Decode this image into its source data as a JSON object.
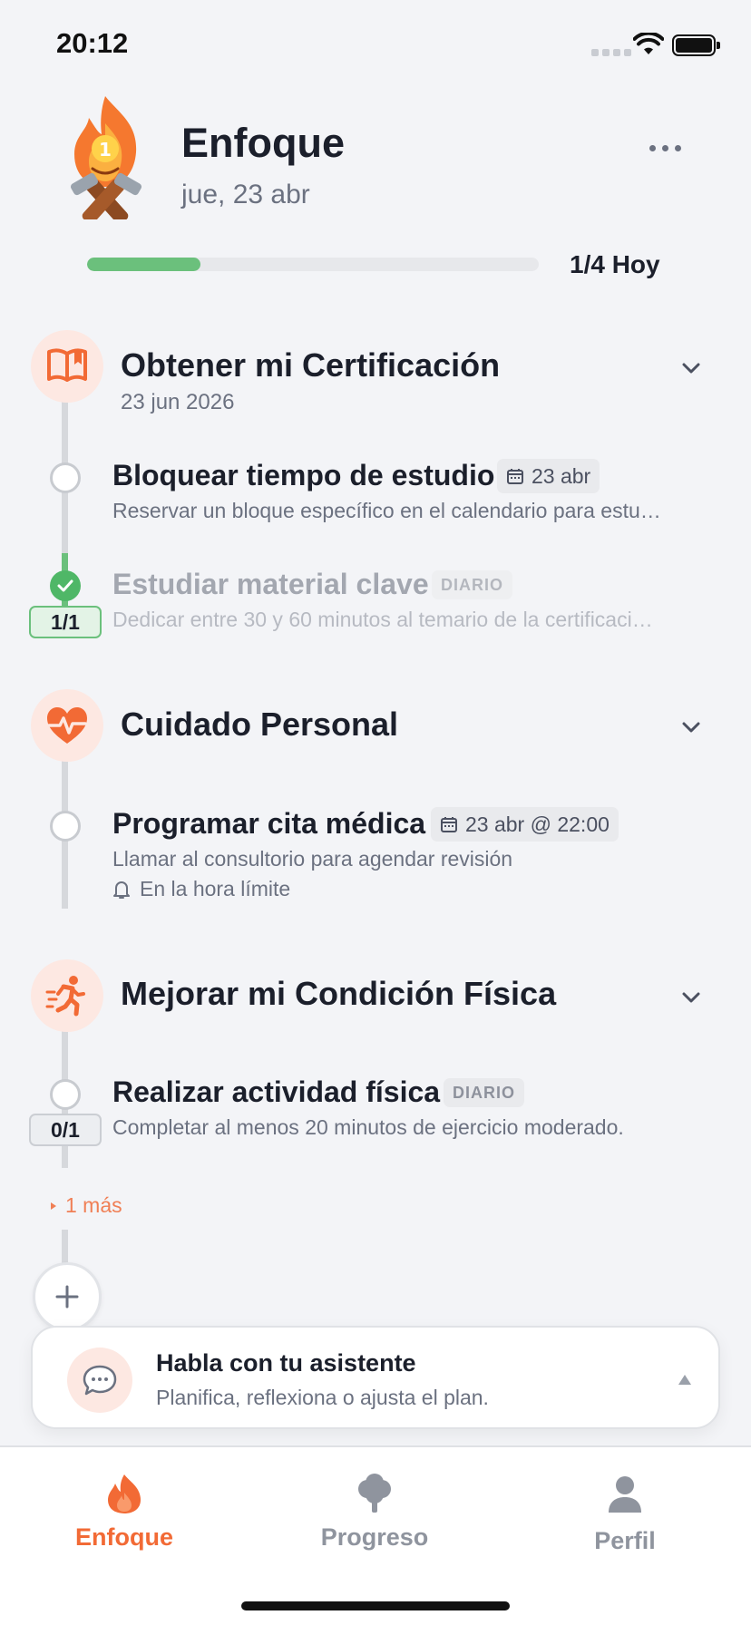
{
  "status_bar": {
    "time": "20:12"
  },
  "header": {
    "title": "Enfoque",
    "date": "jue, 23 abr"
  },
  "progress": {
    "completed": 1,
    "total": 4,
    "fraction": 0.25,
    "label": "1/4 Hoy"
  },
  "goals": [
    {
      "title": "Obtener mi Certificación",
      "date": "23 jun 2026",
      "icon": "book-icon",
      "tasks": [
        {
          "title": "Bloquear tiempo de estudio",
          "chip": "23 abr",
          "description": "Reservar un bloque específico en el calendario para estu…",
          "done": false
        },
        {
          "title": "Estudiar material clave",
          "tag": "DIARIO",
          "description": "Dedicar entre 30 y 60 minutos al temario de la certificaci…",
          "counter": "1/1",
          "done": true
        }
      ]
    },
    {
      "title": "Cuidado Personal",
      "icon": "heart-pulse-icon",
      "tasks": [
        {
          "title": "Programar cita médica",
          "chip": "23 abr @ 22:00",
          "description": "Llamar al consultorio para agendar revisión",
          "reminder": "En la hora límite",
          "done": false
        }
      ]
    },
    {
      "title": "Mejorar mi Condición Física",
      "icon": "running-icon",
      "tasks": [
        {
          "title": "Realizar actividad física",
          "tag": "DIARIO",
          "description": "Completar al menos 20 minutos de ejercicio moderado.",
          "counter": "0/1",
          "done": false
        }
      ],
      "more_label": "1 más"
    }
  ],
  "assistant": {
    "title": "Habla con tu asistente",
    "subtitle": "Planifica, reflexiona o ajusta el plan."
  },
  "tabs": [
    {
      "label": "Enfoque",
      "icon": "flame-icon",
      "active": true
    },
    {
      "label": "Progreso",
      "icon": "tree-icon",
      "active": false
    },
    {
      "label": "Perfil",
      "icon": "person-icon",
      "active": false
    }
  ],
  "colors": {
    "accent": "#f26a35",
    "success": "#6bc07c",
    "muted": "#6b7180"
  }
}
